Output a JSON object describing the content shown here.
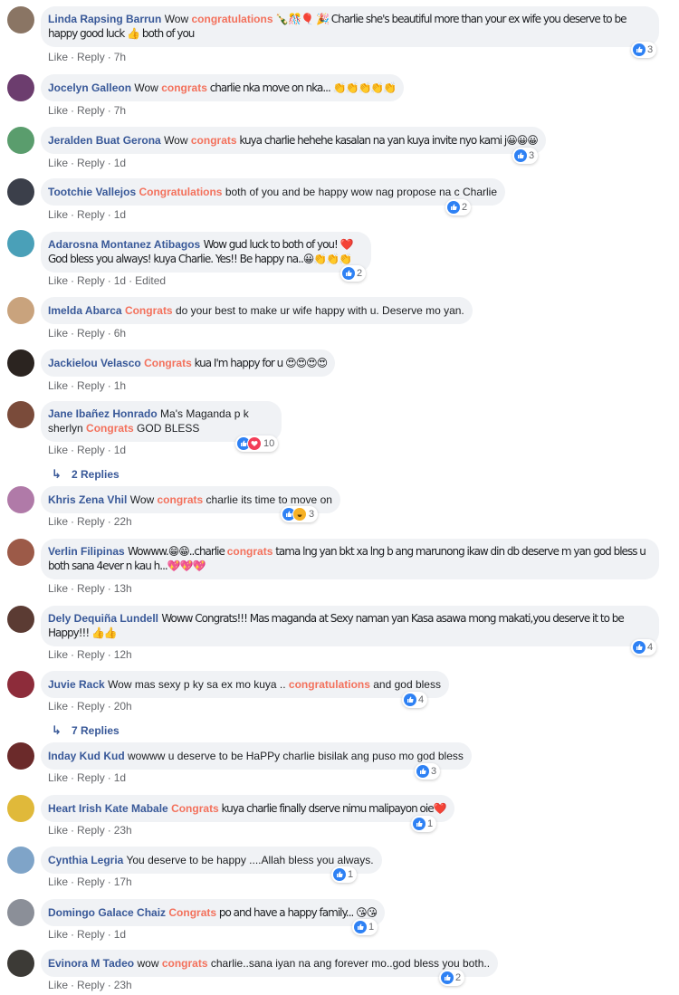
{
  "comments": [
    {
      "author": "Linda Rapsing Barrun",
      "pre": "Wow ",
      "hl": "congratulations",
      "post": " 🍾🎊🎈 🎉 Charlie she's beautiful more than your ex wife you deserve to be happy good luck 👍 both of you",
      "like": "Like",
      "reply": "Reply",
      "time": "7h",
      "reactions": "3",
      "avatar_color": "#8a7564"
    },
    {
      "author": "Jocelyn Galleon",
      "pre": "Wow ",
      "hl": "congrats",
      "post": " charlie nka move on nka... 👏👏👏👏👏",
      "like": "Like",
      "reply": "Reply",
      "time": "7h",
      "reactions": "",
      "avatar_color": "#6c3d6e"
    },
    {
      "author": "Jeralden Buat Gerona",
      "pre": "Wow ",
      "hl": "congrats",
      "post": " kuya charlie hehehe kasalan na yan kuya invite nyo kami j😀😀😀",
      "like": "Like",
      "reply": "Reply",
      "time": "1d",
      "reactions": "3",
      "avatar_color": "#5a9d6d"
    },
    {
      "author": "Tootchie Vallejos",
      "pre": "",
      "hl": "Congratulations",
      "post": " both of you and be happy wow nag propose na c Charlie",
      "like": "Like",
      "reply": "Reply",
      "time": "1d",
      "reactions": "2",
      "avatar_color": "#3b3f4a"
    },
    {
      "author": "Adarosna Montanez Atibagos",
      "pre": "Wow gud luck to both of you! ❤️ God bless you always! kuya Charlie. Yes!! Be happy na..😀👏👏👏",
      "hl": "",
      "post": "",
      "like": "Like",
      "reply": "Reply",
      "time": "1d",
      "edited": "Edited",
      "reactions": "2",
      "avatar_color": "#4aa0b8"
    },
    {
      "author": "Imelda Abarca",
      "pre": "",
      "hl": "Congrats",
      "post": " do your best to make ur wife happy with u. Deserve mo yan.",
      "like": "Like",
      "reply": "Reply",
      "time": "6h",
      "reactions": "",
      "avatar_color": "#c9a37d"
    },
    {
      "author": "Jackielou Velasco",
      "pre": "",
      "hl": "Congrats",
      "post": " kua I'm happy for u 😍😍😍😍",
      "like": "Like",
      "reply": "Reply",
      "time": "1h",
      "reactions": "",
      "avatar_color": "#2b2420"
    },
    {
      "author": "Jane Ibañez Honrado",
      "pre": "Ma's Maganda p k sherlyn ",
      "hl": "Congrats",
      "post": " GOD BLESS",
      "like": "Like",
      "reply": "Reply",
      "time": "1d",
      "reactions": "10",
      "avatar_color": "#7a4b3a",
      "replies": "2 Replies"
    },
    {
      "author": "Khris Zena Vhil",
      "pre": "Wow ",
      "hl": "congrats",
      "post": " charlie its time to move on",
      "like": "Like",
      "reply": "Reply",
      "time": "22h",
      "reactions": "3",
      "avatar_color": "#b07aa8"
    },
    {
      "author": "Verlin Filipinas",
      "pre": "Wowww.😁😁..charlie ",
      "hl": "congrats",
      "post": " tama lng yan bkt xa lng b ang marunong ikaw din db deserve m yan god bless u both sana 4ever n kau h...💖💖💖",
      "like": "Like",
      "reply": "Reply",
      "time": "13h",
      "reactions": "",
      "avatar_color": "#9c5a48"
    },
    {
      "author": "Dely Dequiña Lundell",
      "pre": "Woww Congrats!!! Mas maganda at Sexy naman yan Kasa asawa mong makati,you deserve it to be Happy!!! 👍👍",
      "hl": "",
      "post": "",
      "like": "Like",
      "reply": "Reply",
      "time": "12h",
      "reactions": "4",
      "avatar_color": "#5b3b33"
    },
    {
      "author": "Juvie Rack",
      "pre": "Wow mas sexy p ky sa ex mo kuya .. ",
      "hl": "congratulations",
      "post": " and god bless",
      "like": "Like",
      "reply": "Reply",
      "time": "20h",
      "reactions": "4",
      "avatar_color": "#8d2c3a",
      "replies": "7 Replies"
    },
    {
      "author": "Inday Kud Kud",
      "pre": "wowww u deserve to be HaPPy charlie bisilak ang puso mo god bless",
      "hl": "",
      "post": "",
      "like": "Like",
      "reply": "Reply",
      "time": "1d",
      "reactions": "3",
      "avatar_color": "#6b2a2a"
    },
    {
      "author": "Heart Irish Kate Mabale",
      "pre": "",
      "hl": "Congrats",
      "post": " kuya charlie finally dserve nimu malipayon oie❤️",
      "like": "Like",
      "reply": "Reply",
      "time": "23h",
      "reactions": "1",
      "avatar_color": "#e0b93a"
    },
    {
      "author": "Cynthia Legria",
      "pre": "You deserve to be happy ....Allah bless you always.",
      "hl": "",
      "post": "",
      "like": "Like",
      "reply": "Reply",
      "time": "17h",
      "reactions": "1",
      "avatar_color": "#7fa4c8"
    },
    {
      "author": "Domingo Galace Chaiz",
      "pre": "",
      "hl": "Congrats",
      "post": " po and have a happy family... 😘😘",
      "like": "Like",
      "reply": "Reply",
      "time": "1d",
      "reactions": "1",
      "avatar_color": "#8b8f98"
    },
    {
      "author": "Evinora M Tadeo",
      "pre": "wow ",
      "hl": "congrats",
      "post": " charlie..sana iyan na ang forever mo..god bless you both..",
      "like": "Like",
      "reply": "Reply",
      "time": "23h",
      "reactions": "2",
      "avatar_color": "#3c3a36"
    }
  ],
  "reaction_colors": {
    "like": "#2e81f4",
    "love": "#f33e58",
    "haha": "#f7b125"
  },
  "link_color": "#385898",
  "highlight_color": "#f3715c"
}
